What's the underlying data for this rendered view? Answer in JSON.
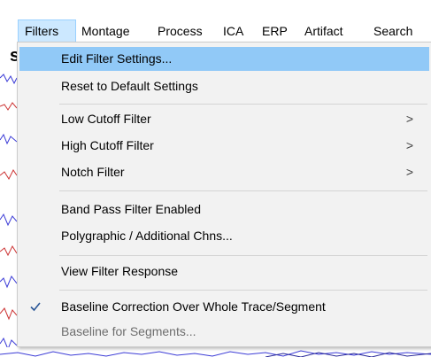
{
  "menubar": {
    "items": [
      {
        "label": "Filters"
      },
      {
        "label": "Montage"
      },
      {
        "label": "Process"
      },
      {
        "label": "ICA"
      },
      {
        "label": "ERP"
      },
      {
        "label": "Artifact"
      },
      {
        "label": "Search"
      }
    ]
  },
  "background": {
    "partial_letter": "s"
  },
  "filters_menu": {
    "items": [
      {
        "label": "Edit Filter Settings..."
      },
      {
        "label": "Reset to Default Settings"
      },
      {
        "label": "Low Cutoff Filter",
        "arrow": ">"
      },
      {
        "label": "High Cutoff Filter",
        "arrow": ">"
      },
      {
        "label": "Notch Filter",
        "arrow": ">"
      },
      {
        "label": "Band Pass Filter Enabled"
      },
      {
        "label": "Polygraphic / Additional Chns..."
      },
      {
        "label": "View Filter Response"
      },
      {
        "label": "Baseline Correction Over Whole Trace/Segment",
        "checked": true
      },
      {
        "label": "Baseline for Segments...",
        "disabled": true
      }
    ]
  },
  "colors": {
    "highlight": "#91c9f7",
    "menubar_active": "#cce8ff",
    "menu_bg": "#f2f2f2",
    "check": "#2b5797"
  }
}
